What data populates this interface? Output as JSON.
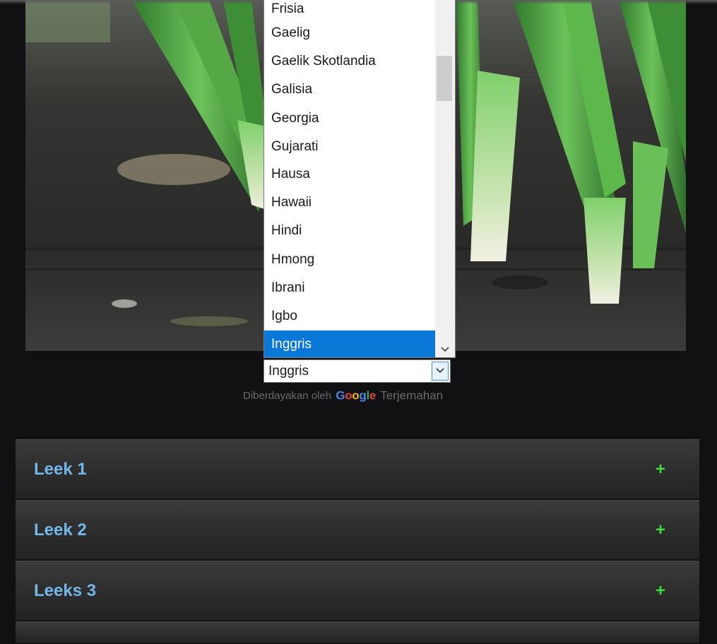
{
  "language_list": {
    "items": [
      "Frisia",
      "Gaelig",
      "Gaelik Skotlandia",
      "Galisia",
      "Georgia",
      "Gujarati",
      "Hausa",
      "Hawaii",
      "Hindi",
      "Hmong",
      "Ibrani",
      "Igbo",
      "Inggris"
    ],
    "selected": "Inggris",
    "scroll_down_icon": "chevron-down-icon"
  },
  "language_select": {
    "value": "Inggris",
    "icon": "chevron-down-icon"
  },
  "powered_by": {
    "prefix": "Diberdayakan oleh",
    "brand": "Google",
    "link": "Terjemahan"
  },
  "accordion": {
    "items": [
      {
        "title": "Leek 1",
        "toggle": "+"
      },
      {
        "title": "Leek 2",
        "toggle": "+"
      },
      {
        "title": "Leeks 3",
        "toggle": "+"
      }
    ]
  },
  "colors": {
    "page_bg": "#111113",
    "accordion_title": "#74b8ea",
    "accordion_plus": "#3fdc3f",
    "selection": "#0a78d7"
  }
}
